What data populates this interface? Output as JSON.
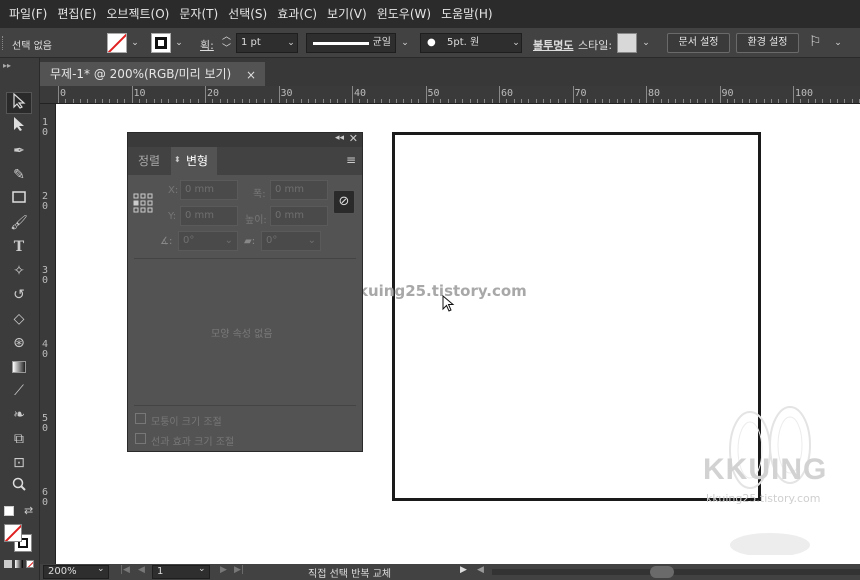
{
  "menu": [
    "파일(F)",
    "편집(E)",
    "오브젝트(O)",
    "문자(T)",
    "선택(S)",
    "효과(C)",
    "보기(V)",
    "윈도우(W)",
    "도움말(H)"
  ],
  "control": {
    "selection_label": "선택 없음",
    "stroke_weight_label": "획:",
    "stroke_weight_value": "1 pt",
    "profile_label": "균일",
    "brush_value": "5pt. 원",
    "opacity_label": "불투명도",
    "style_label": "스타일:",
    "doc_setup_button": "문서 설정",
    "prefs_button": "환경 설정"
  },
  "document_tab": {
    "title": "무제-1* @ 200%(RGB/미리 보기)",
    "close": "×"
  },
  "ruler": {
    "h_labels": [
      "0",
      "10",
      "20",
      "30",
      "40",
      "50",
      "60",
      "70",
      "80",
      "90",
      "100"
    ],
    "v_labels": [
      "1 0",
      "2 0",
      "3 0",
      "4 0",
      "5 0",
      "6 0"
    ]
  },
  "panel": {
    "tab_align": "정렬",
    "tab_transform": "변형",
    "x_label": "X:",
    "y_label": "Y:",
    "w_label": "폭:",
    "h_label": "높이:",
    "x_value": "0 mm",
    "y_value": "0 mm",
    "w_value": "0 mm",
    "h_value": "0 mm",
    "rotate_value": "0°",
    "shear_value": "0°",
    "empty_message": "모양 속성 없음",
    "scale_corners": "모퉁이 크기 조절",
    "scale_strokes": "선과 효과 크기 조절"
  },
  "status": {
    "zoom": "200%",
    "page": "1",
    "tool_text": "직접 선택 반복 교체"
  },
  "watermark": {
    "center_text": "kkuing25.tistory.com",
    "logo_text": "KKUING",
    "logo_sub": "kkuing25.tistory.com"
  }
}
